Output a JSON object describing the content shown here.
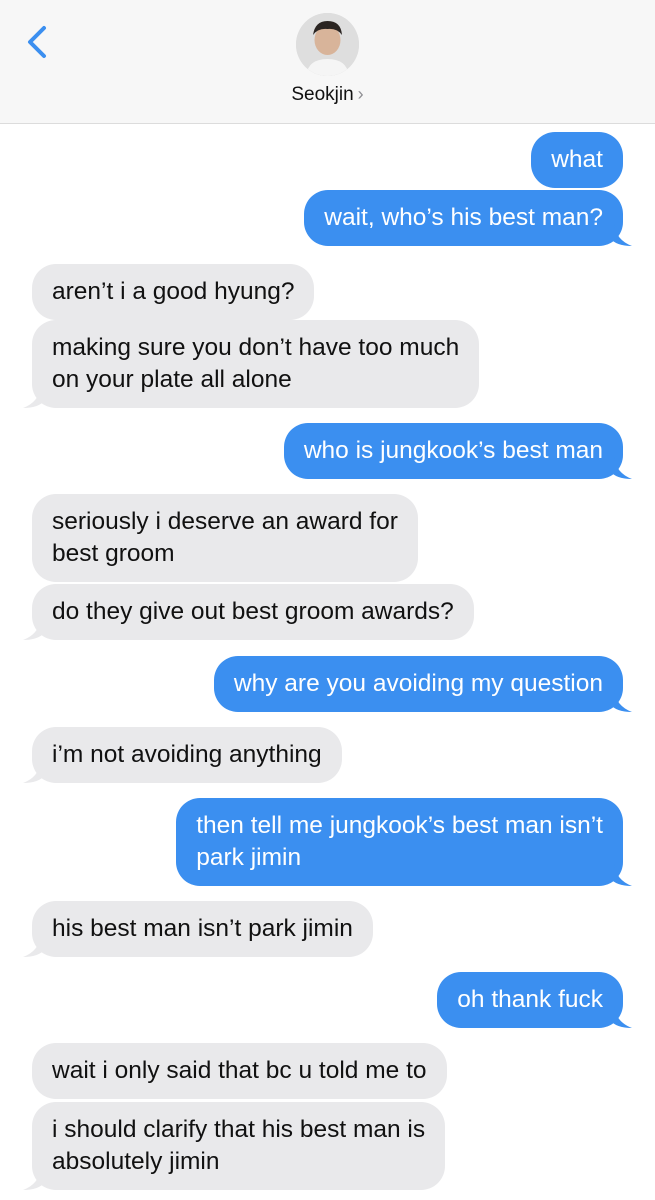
{
  "header": {
    "contact_name": "Seokjin",
    "chevron": "›",
    "back_icon": "chevron-left-icon",
    "accent_color": "#3b8ff0"
  },
  "messages": [
    {
      "dir": "out",
      "lines": [
        "what"
      ]
    },
    {
      "dir": "out",
      "lines": [
        "wait, who’s his best man?"
      ]
    },
    {
      "dir": "in",
      "lines": [
        "aren’t i a good hyung?"
      ]
    },
    {
      "dir": "in",
      "lines": [
        "making sure you don’t have too much",
        "on your plate all alone"
      ]
    },
    {
      "dir": "out",
      "lines": [
        "who is jungkook’s best man"
      ]
    },
    {
      "dir": "in",
      "lines": [
        "seriously i deserve an award for",
        "best groom"
      ]
    },
    {
      "dir": "in",
      "lines": [
        "do they give out best groom awards?"
      ]
    },
    {
      "dir": "out",
      "lines": [
        "why are you avoiding my question"
      ]
    },
    {
      "dir": "in",
      "lines": [
        "i’m not avoiding anything"
      ]
    },
    {
      "dir": "out",
      "lines": [
        "then tell me jungkook’s best man isn’t",
        "park jimin"
      ]
    },
    {
      "dir": "in",
      "lines": [
        "his best man isn’t park jimin"
      ]
    },
    {
      "dir": "out",
      "lines": [
        "oh thank fuck"
      ]
    },
    {
      "dir": "in",
      "lines": [
        "wait i only said that bc u told me to"
      ]
    },
    {
      "dir": "in",
      "lines": [
        "i should clarify that his best man is",
        "absolutely jimin"
      ]
    }
  ]
}
